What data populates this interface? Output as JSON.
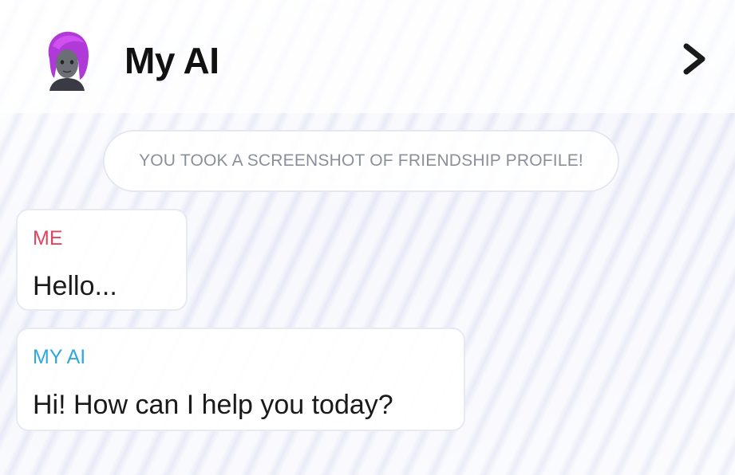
{
  "header": {
    "title": "My AI",
    "avatar_icon": "bitmoji-avatar-icon",
    "chevron_icon": "chevron-right-icon"
  },
  "notice": {
    "text": "YOU TOOK A SCREENSHOT OF FRIENDSHIP PROFILE!"
  },
  "messages": [
    {
      "sender": "ME",
      "text": "Hello...",
      "sender_color": "#e0455f"
    },
    {
      "sender": "MY AI",
      "text": "Hi! How can I help you today?",
      "sender_color": "#2fa8dc"
    }
  ],
  "colors": {
    "title": "#111111",
    "notice_text": "#8b8f99",
    "me_label": "#e0455f",
    "ai_label": "#2fa8dc",
    "avatar_hair": "#b03ad8"
  }
}
